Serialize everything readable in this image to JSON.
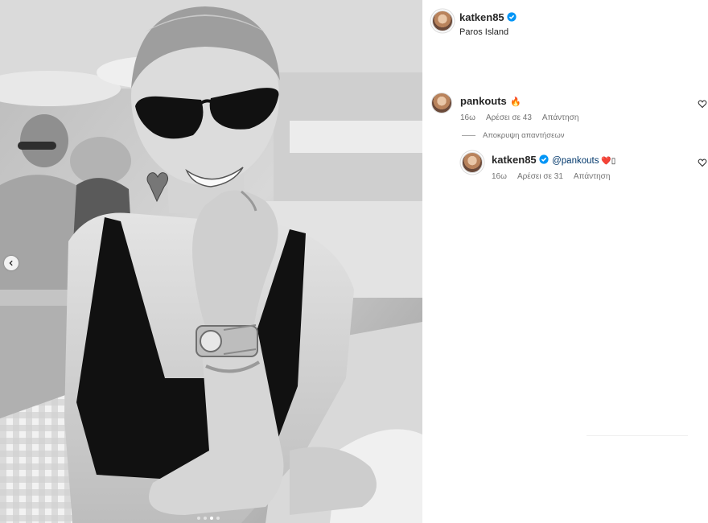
{
  "post": {
    "author": "katken85",
    "location": "Paros Island",
    "carousel": {
      "total": 4,
      "active": 3
    }
  },
  "comments": [
    {
      "username": "pankouts",
      "text": "",
      "emoji": "🔥",
      "time": "16ω",
      "likes": "Αρέσει σε 43",
      "reply_label": "Απάντηση"
    }
  ],
  "hide_replies_label": "Αποκρυψη απαντήσεων",
  "replies": [
    {
      "username": "katken85",
      "mention": "@pankouts",
      "text": " ❤️▯",
      "time": "16ω",
      "likes": "Αρέσει σε 31",
      "reply_label": "Απάντηση"
    }
  ],
  "icons": {
    "verified": "verified-badge-icon",
    "like": "heart-outline-icon",
    "prev": "chevron-left-icon"
  },
  "colors": {
    "verified": "#0095f6",
    "meta": "#737373",
    "mention": "#00376b"
  }
}
